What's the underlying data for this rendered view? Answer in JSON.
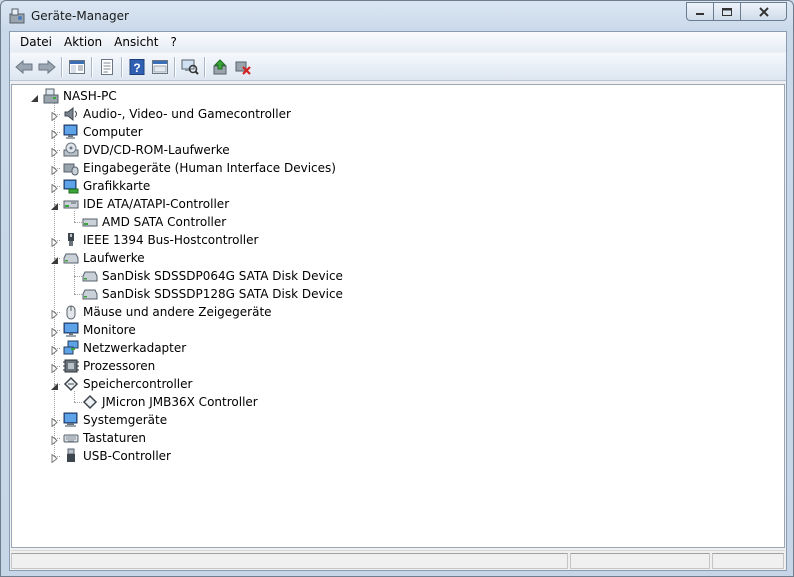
{
  "window": {
    "title": "Geräte-Manager"
  },
  "menu": [
    "Datei",
    "Aktion",
    "Ansicht",
    "?"
  ],
  "toolbar": [
    "back-icon",
    "forward-icon",
    "console-tree-icon",
    "properties-icon",
    "help-icon",
    "show-hidden-icon",
    "scan-hardware-icon",
    "update-driver-icon",
    "disable-device-icon"
  ],
  "tree": {
    "root": "NASH-PC",
    "categories": [
      {
        "label": "Audio-, Video- und Gamecontroller",
        "icon": "speaker-icon",
        "expanded": false
      },
      {
        "label": "Computer",
        "icon": "computer-icon",
        "expanded": false
      },
      {
        "label": "DVD/CD-ROM-Laufwerke",
        "icon": "dvd-drive-icon",
        "expanded": false
      },
      {
        "label": "Eingabegeräte (Human Interface Devices)",
        "icon": "hid-icon",
        "expanded": false
      },
      {
        "label": "Grafikkarte",
        "icon": "display-adapter-icon",
        "expanded": false
      },
      {
        "label": "IDE ATA/ATAPI-Controller",
        "icon": "ide-controller-icon",
        "expanded": true,
        "children": [
          "AMD SATA Controller"
        ]
      },
      {
        "label": "IEEE 1394 Bus-Hostcontroller",
        "icon": "firewire-icon",
        "expanded": false
      },
      {
        "label": "Laufwerke",
        "icon": "disk-drive-icon",
        "expanded": true,
        "children": [
          "SanDisk SDSSDP064G SATA Disk Device",
          "SanDisk SDSSDP128G SATA Disk Device"
        ]
      },
      {
        "label": "Mäuse und andere Zeigegeräte",
        "icon": "mouse-icon",
        "expanded": false
      },
      {
        "label": "Monitore",
        "icon": "monitor-icon",
        "expanded": false
      },
      {
        "label": "Netzwerkadapter",
        "icon": "network-adapter-icon",
        "expanded": false
      },
      {
        "label": "Prozessoren",
        "icon": "processor-icon",
        "expanded": false
      },
      {
        "label": "Speichercontroller",
        "icon": "storage-controller-icon",
        "expanded": true,
        "children": [
          "JMicron JMB36X Controller"
        ]
      },
      {
        "label": "Systemgeräte",
        "icon": "system-devices-icon",
        "expanded": false
      },
      {
        "label": "Tastaturen",
        "icon": "keyboard-icon",
        "expanded": false
      },
      {
        "label": "USB-Controller",
        "icon": "usb-icon",
        "expanded": false
      }
    ]
  },
  "colors": {
    "frame": "#c6d6e8",
    "tree_background": "#ffffff",
    "close_button": "#c75050"
  }
}
